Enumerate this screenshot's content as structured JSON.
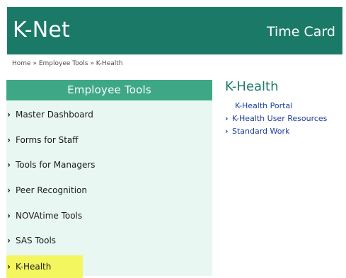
{
  "header": {
    "brand": "K-Net",
    "timecard": "Time Card"
  },
  "breadcrumb": {
    "items": [
      "Home",
      "Employee Tools",
      "K-Health"
    ],
    "separator": "»"
  },
  "sidebar": {
    "title": "Employee Tools",
    "items": [
      {
        "label": "Master Dashboard"
      },
      {
        "label": "Forms for Staff"
      },
      {
        "label": "Tools for Managers"
      },
      {
        "label": "Peer Recognition"
      },
      {
        "label": "NOVAtime Tools"
      },
      {
        "label": "SAS Tools"
      },
      {
        "label": "K-Health"
      }
    ],
    "active_index": 6,
    "chevron_icon": "chevron-right-icon"
  },
  "content": {
    "title": "K-Health",
    "links": [
      {
        "label": "K-Health Portal"
      },
      {
        "label": "K-Health User Resources"
      },
      {
        "label": "Standard Work"
      }
    ]
  },
  "colors": {
    "header": "#1b7a67",
    "sidebar_title": "#3ea886",
    "sidebar_bg": "#e8f7f2",
    "active_highlight": "#f4f65f",
    "link": "#1f3e9a"
  }
}
